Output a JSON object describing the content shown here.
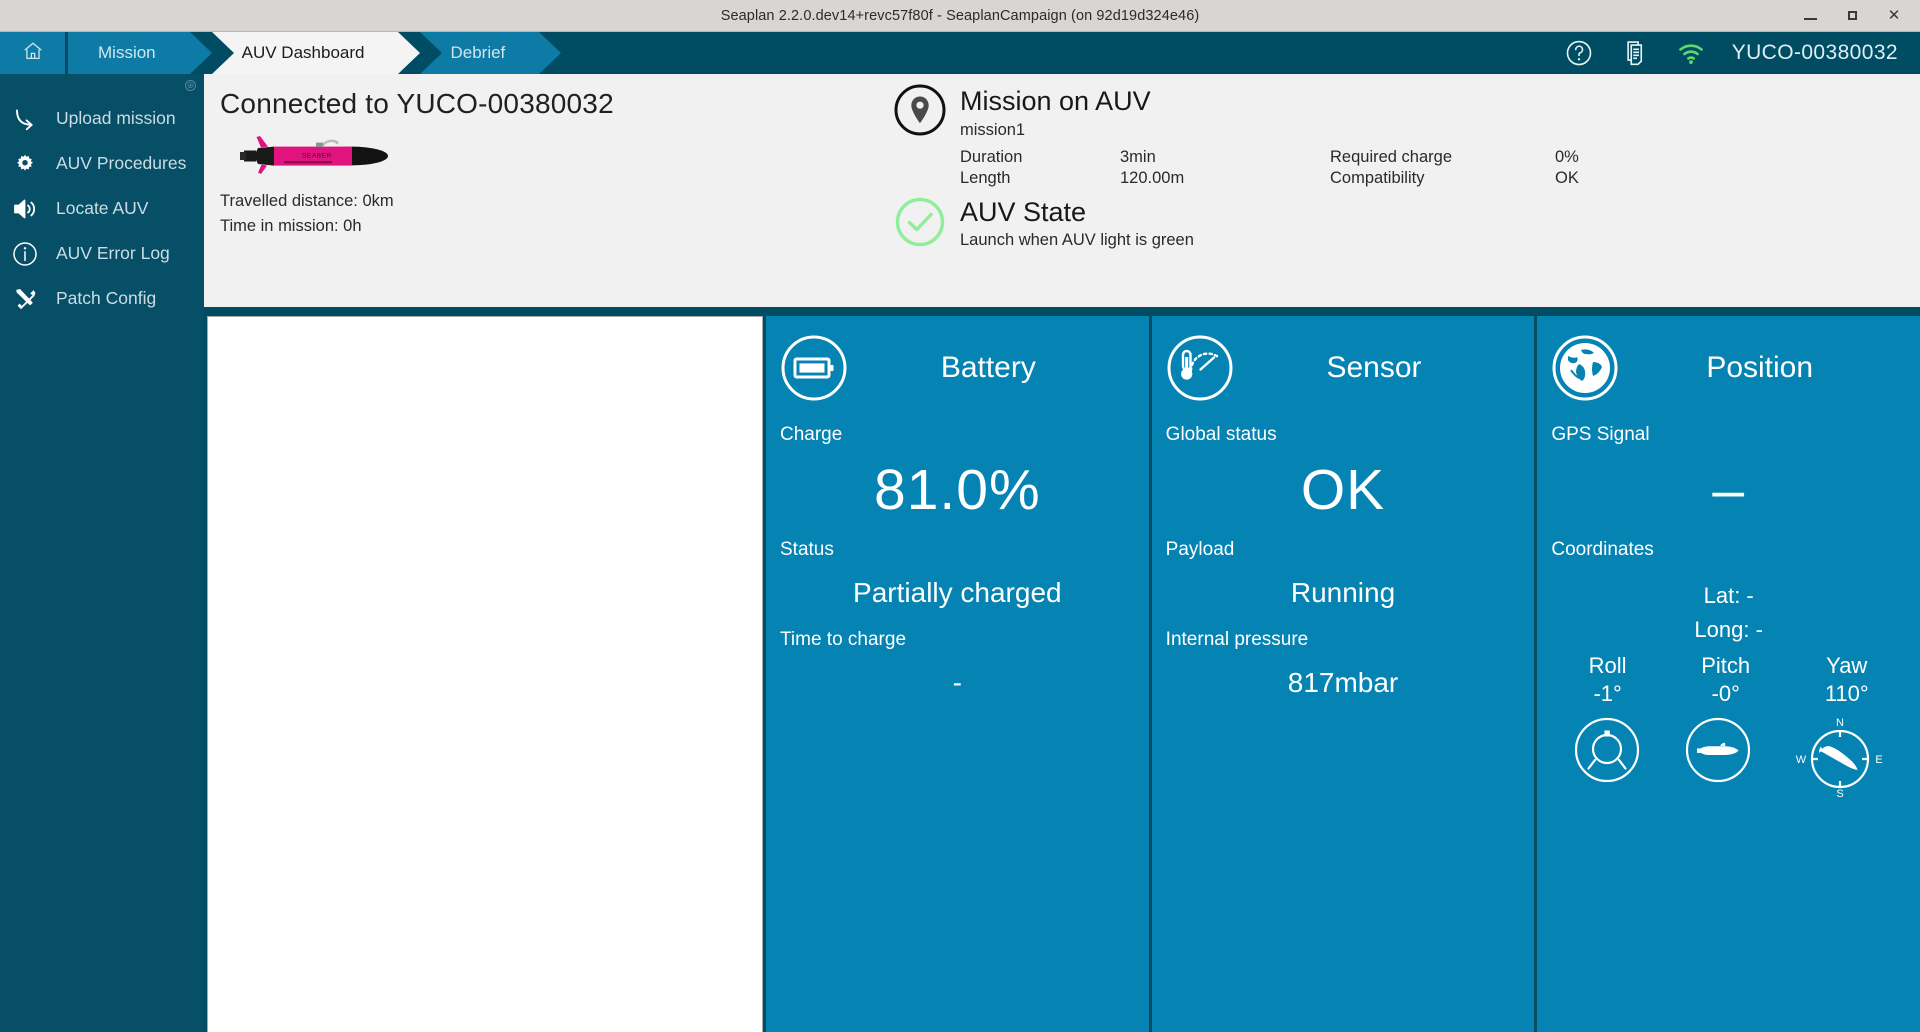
{
  "window": {
    "title": "Seaplan 2.2.0.dev14+revc57f80f - SeaplanCampaign (on 92d19d324e46)",
    "minimize": "minimize-button",
    "maximize": "maximize-button",
    "close": "✕"
  },
  "nav": {
    "home_icon": "home-icon",
    "tabs": [
      {
        "label": "Mission",
        "active": false
      },
      {
        "label": "AUV Dashboard",
        "active": true
      },
      {
        "label": "Debrief",
        "active": false
      }
    ],
    "help_icon": "question-mark-icon",
    "docs_icon": "documents-icon",
    "wifi_icon": "wifi-icon",
    "device_id": "YUCO-00380032"
  },
  "sidebar": {
    "items": [
      {
        "label": "Upload mission",
        "icon": "upload-arrow-icon"
      },
      {
        "label": "AUV Procedures",
        "icon": "gear-icon"
      },
      {
        "label": "Locate AUV",
        "icon": "speaker-icon"
      },
      {
        "label": "AUV Error Log",
        "icon": "info-circle-icon"
      },
      {
        "label": "Patch Config",
        "icon": "tools-icon"
      }
    ]
  },
  "info": {
    "connected_title": "Connected to YUCO-00380032",
    "auv_image": "auv-vehicle-image",
    "travelled_distance": "Travelled distance: 0km",
    "time_in_mission": "Time in mission: 0h"
  },
  "mission": {
    "icon": "map-pin-icon",
    "title": "Mission on AUV",
    "name": "mission1",
    "rows": [
      {
        "label": "Duration",
        "value": "3min",
        "label2": "Required charge",
        "value2": "0%"
      },
      {
        "label": "Length",
        "value": "120.00m",
        "label2": "Compatibility",
        "value2": "OK"
      }
    ]
  },
  "auv_state": {
    "icon": "check-circle-icon",
    "title": "AUV State",
    "message": "Launch when AUV light is green",
    "color": "#90ee9a"
  },
  "cards": {
    "battery": {
      "icon": "battery-icon",
      "title": "Battery",
      "charge_label": "Charge",
      "charge_value": "81.0%",
      "status_label": "Status",
      "status_value": "Partially charged",
      "time_label": "Time to charge",
      "time_value": "-"
    },
    "sensor": {
      "icon": "thermometer-gauge-icon",
      "title": "Sensor",
      "global_label": "Global status",
      "global_value": "OK",
      "payload_label": "Payload",
      "payload_value": "Running",
      "pressure_label": "Internal pressure",
      "pressure_value": "817mbar"
    },
    "position": {
      "icon": "globe-icon",
      "title": "Position",
      "gps_label": "GPS Signal",
      "gps_value": "–",
      "coords_label": "Coordinates",
      "lat": "Lat: -",
      "long": "Long: -",
      "roll_label": "Roll",
      "roll_value": "-1°",
      "pitch_label": "Pitch",
      "pitch_value": "-0°",
      "yaw_label": "Yaw",
      "yaw_value": "110°",
      "compass_n": "N",
      "compass_e": "E",
      "compass_s": "S",
      "compass_w": "W"
    }
  },
  "colors": {
    "panel_blue": "#0583b3",
    "nav_blue": "#0e7ba6",
    "dark_blue": "#004d63",
    "sidebar_blue": "#064f66",
    "green": "#5ed96e"
  }
}
